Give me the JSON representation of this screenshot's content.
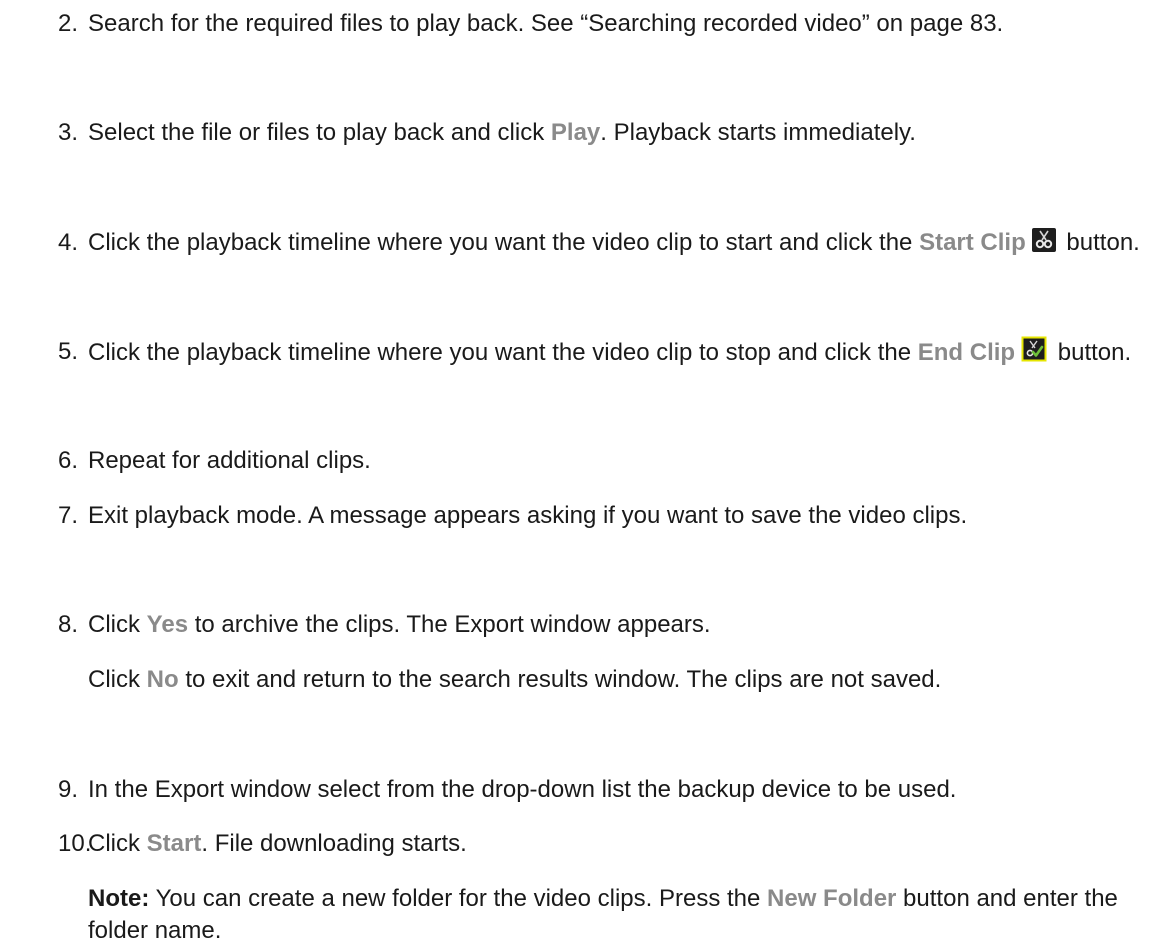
{
  "steps": [
    {
      "num": "2.",
      "text": "Search for the required files to play back. See “Searching recorded video” on page 83."
    },
    {
      "num": "3.",
      "before": "Select the file or files to play back and click ",
      "highlight": "Play",
      "after": ". Playback starts immediately."
    },
    {
      "num": "4.",
      "before": "Click the playback timeline where you want the video clip to start and click the ",
      "highlight": "Start Clip",
      "icon": "scissors-clip-start-icon",
      "after": " button."
    },
    {
      "num": "5.",
      "before": "Click the playback timeline where you want the video clip to stop and click the ",
      "highlight": "End Clip",
      "icon": "scissors-clip-end-icon",
      "after": " button."
    },
    {
      "num": "6.",
      "text": "Repeat for additional clips."
    },
    {
      "num": "7.",
      "text": "Exit playback mode. A message appears asking if you want to save the video clips."
    },
    {
      "num": "8.",
      "highlight": "Yes",
      "before_prefix": "Click ",
      "after": " to archive the clips. The Export window appears."
    },
    {
      "num": "9.",
      "text": "In the Export window select from the drop-down list the backup device to be used."
    },
    {
      "num": "10.",
      "before_prefix": "Click ",
      "highlight": "Start",
      "after": ". File downloading starts."
    }
  ],
  "step8_continuation": {
    "prefix": "Click ",
    "highlight": "No",
    "after": " to exit and return to the search results window. The clips are not saved."
  },
  "step10_note": {
    "label": "Note:",
    "before": " You can create a new folder for the video clips. Press the ",
    "highlight": "New Folder",
    "after": " button and enter the folder name."
  },
  "colors": {
    "text": "#1a1a1a",
    "highlight": "#8a8a8a",
    "icon_bg": "#1e1e1e",
    "icon_border_yellow": "#e6e600",
    "icon_check": "#6fbf3a"
  }
}
